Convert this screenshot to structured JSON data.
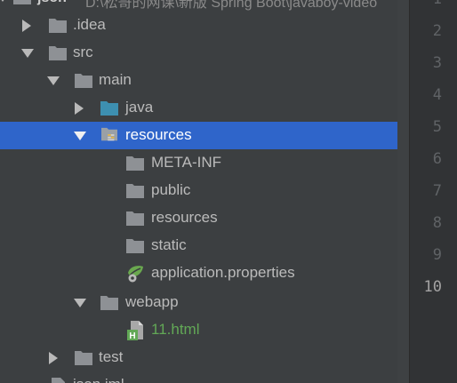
{
  "top_partial": {
    "name": "json",
    "path": "D:\\松哥的网课\\新版 Spring Boot\\javaboy-video"
  },
  "tree": {
    "idea": "idea",
    "src": "src",
    "main": "main",
    "java": "java",
    "resources_root": "resources",
    "meta_inf": "META-INF",
    "public": "public",
    "resources": "resources",
    "static": "static",
    "app_props": "application.properties",
    "webapp": "webapp",
    "html_file": "11.html",
    "test": "test",
    "bottom_partial": "json.iml"
  },
  "gutter": {
    "lines": [
      "1",
      "2",
      "3",
      "4",
      "5",
      "6",
      "7",
      "8",
      "9",
      "10"
    ],
    "current_line": "10"
  },
  "colors": {
    "background": "#3c3f41",
    "selection": "#2f65ca",
    "gutter_bg": "#313335",
    "text": "#bbbbbb",
    "green_text": "#62a856",
    "folder_grey": "#8e9195",
    "folder_blue": "#3d8fb0"
  }
}
